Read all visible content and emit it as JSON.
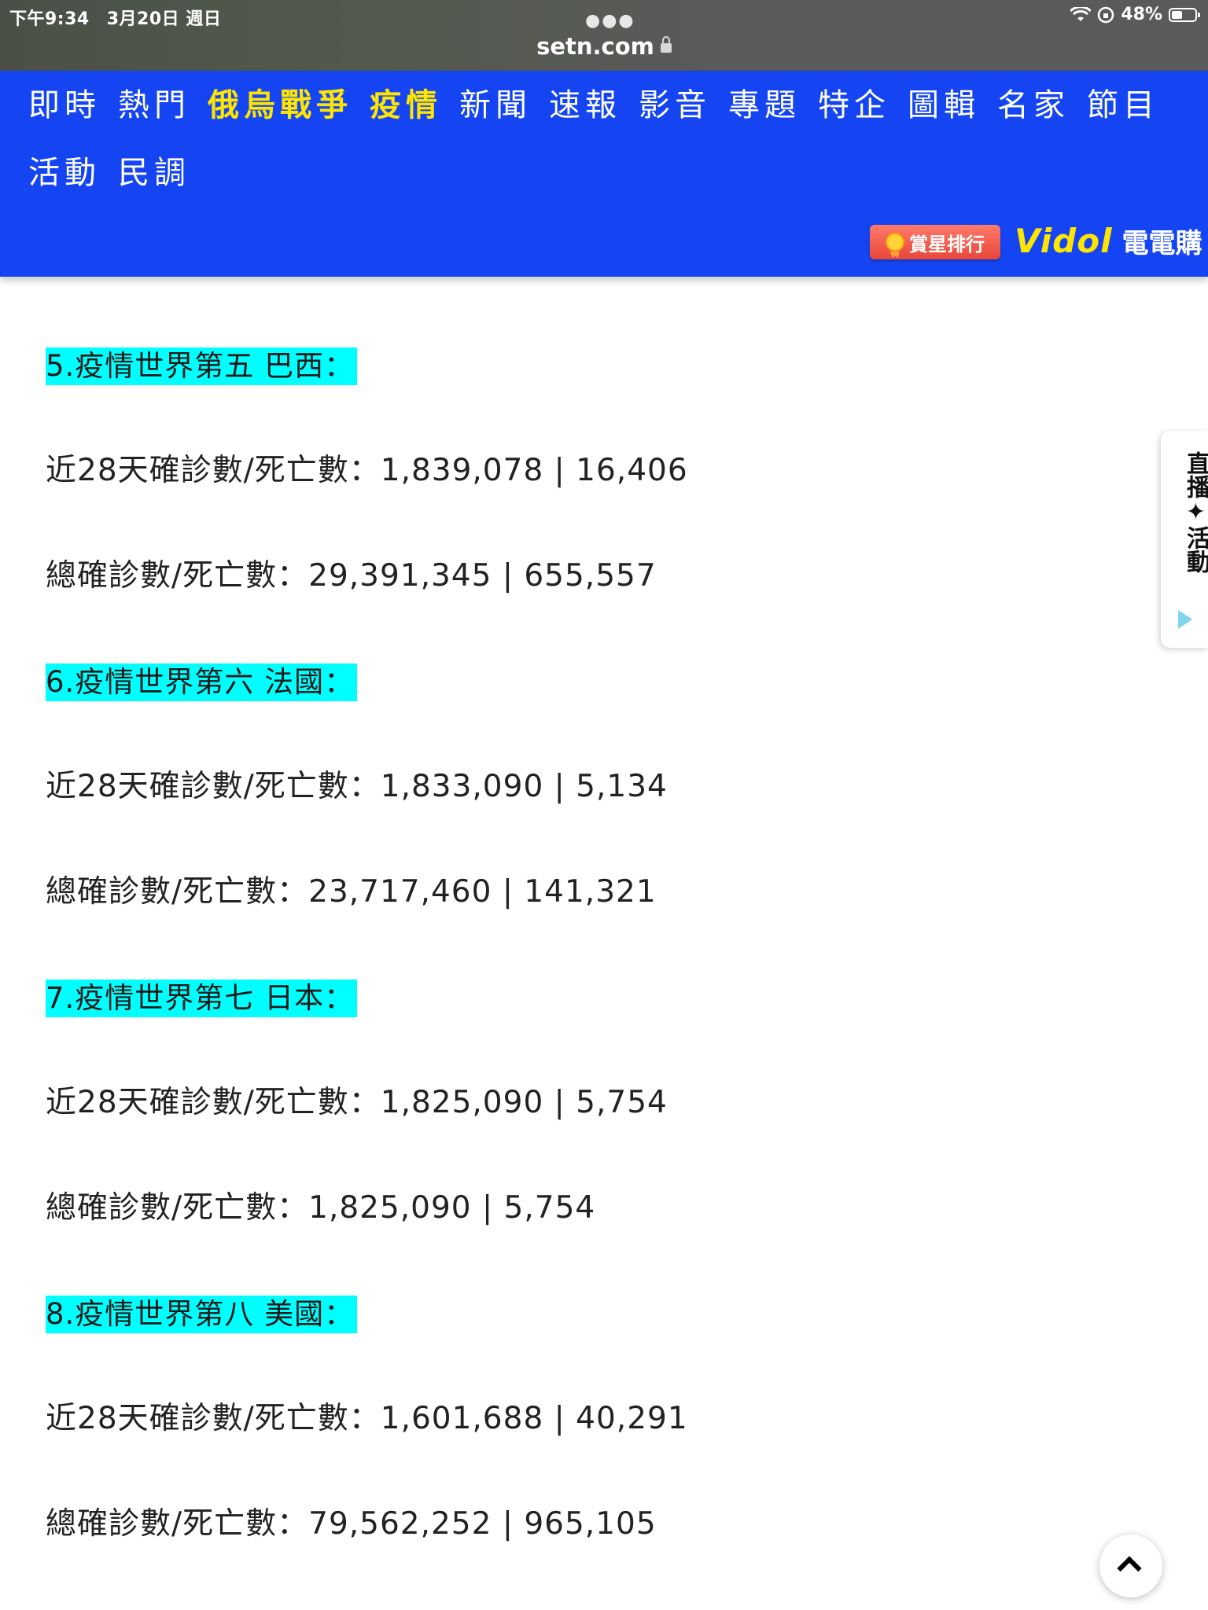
{
  "status_bar": {
    "time": "下午9:34",
    "date": "3月20日 週日",
    "url": "setn.com",
    "battery": "48%",
    "battery_level": 0.48
  },
  "nav": {
    "items": [
      "即時",
      "熱門",
      "俄烏戰爭",
      "疫情",
      "新聞",
      "速報",
      "影音",
      "專題",
      "特企",
      "圖輯",
      "名家",
      "節目",
      "活動",
      "民調"
    ],
    "highlight_color": "#ffe600",
    "background_color": "#1545f2",
    "rank_badge": "賞星排行",
    "vidol_logo": "Vidol",
    "vidol_text": "電電購"
  },
  "sections": [
    {
      "heading": "5.疫情世界第五 巴西：",
      "recent": "近28天確診數/死亡數：1,839,078 | 16,406",
      "total": "總確診數/死亡數：29,391,345 | 655,557"
    },
    {
      "heading": "6.疫情世界第六 法國：",
      "recent": "近28天確診數/死亡數：1,833,090 | 5,134",
      "total": "總確診數/死亡數：23,717,460 | 141,321"
    },
    {
      "heading": "7.疫情世界第七 日本：",
      "recent": "近28天確診數/死亡數：1,825,090 | 5,754",
      "total": "總確診數/死亡數：1,825,090 | 5,754"
    },
    {
      "heading": "8.疫情世界第八 美國：",
      "recent": "近28天確診數/死亡數：1,601,688 | 40,291",
      "total": "總確診數/死亡數：79,562,252 | 965,105"
    }
  ],
  "highlight_bg": "#00ffff",
  "side_tab": {
    "label": "直播✦活動"
  },
  "icons": {
    "lock": "lock-icon",
    "wifi": "wifi-icon",
    "battery": "battery-icon",
    "back_to_top": "chevron-up-icon"
  }
}
